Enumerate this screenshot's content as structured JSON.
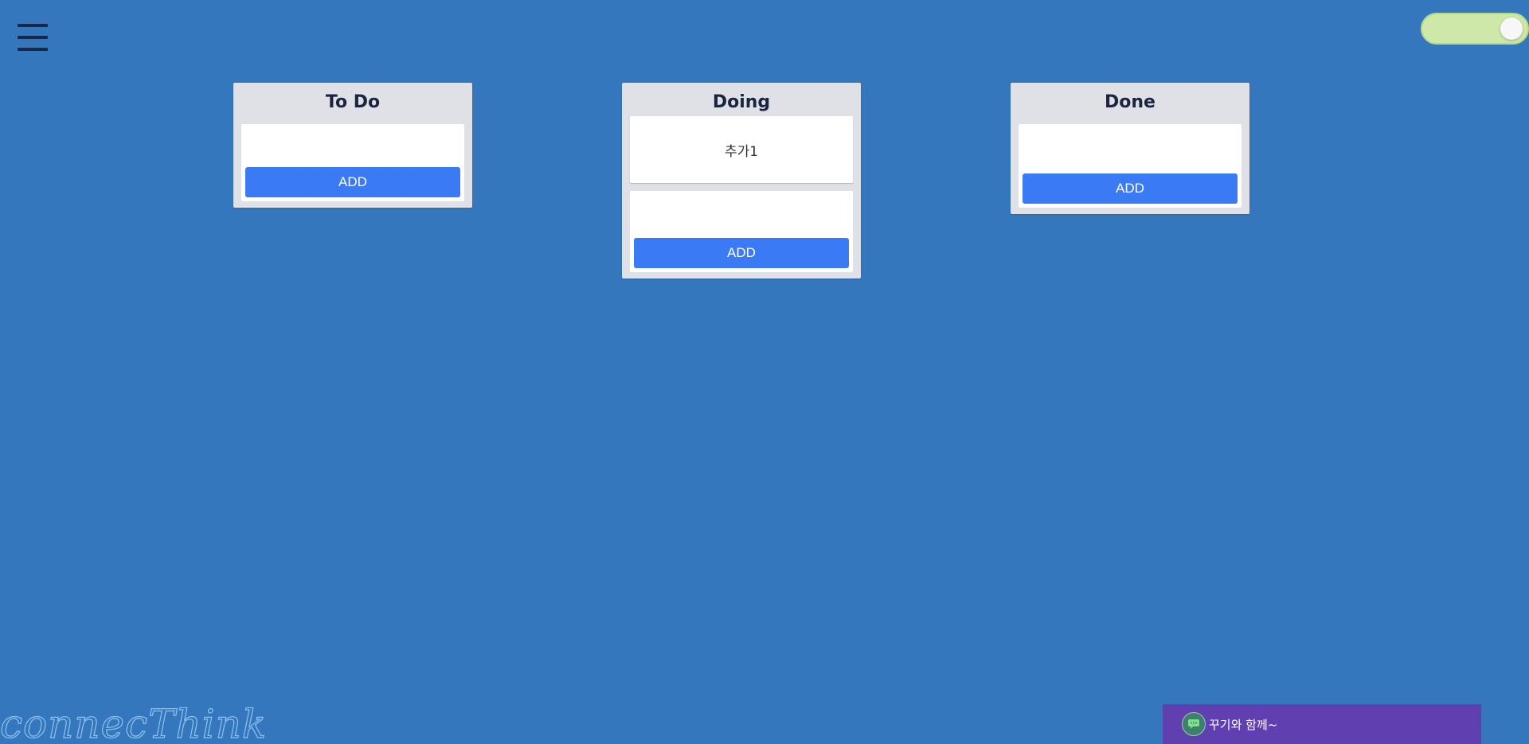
{
  "header": {
    "menu_icon": "hamburger-menu-icon",
    "theme_toggle": {
      "state": "on",
      "color": "#cde8a8"
    }
  },
  "boards": [
    {
      "title": "To Do",
      "cards": [],
      "input_value": "",
      "add_label": "ADD"
    },
    {
      "title": "Doing",
      "cards": [
        "추가1"
      ],
      "input_value": "",
      "add_label": "ADD"
    },
    {
      "title": "Done",
      "cards": [],
      "input_value": "",
      "add_label": "ADD"
    }
  ],
  "footer": {
    "logo_text": "connecThink",
    "chat": {
      "icon": "chat-bubble-icon",
      "label": "꾸기와 함께~"
    }
  },
  "colors": {
    "background": "#3577bd",
    "board": "#dfe1e6",
    "button": "#3a7af5",
    "chat_bar": "#6040b0"
  }
}
